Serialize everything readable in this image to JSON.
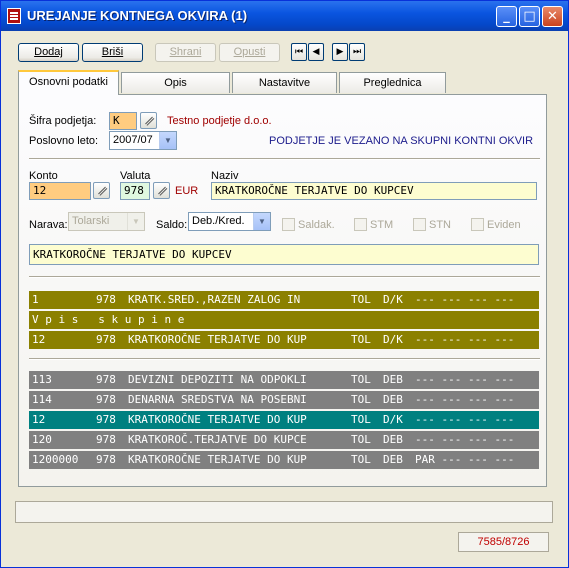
{
  "window": {
    "title": "UREJANJE KONTNEGA OKVIRA (1)",
    "minimize": "_",
    "maximize": "□",
    "close": "✕"
  },
  "toolbar": {
    "dodaj": "Dodaj",
    "brisi": "Briši",
    "shrani": "Shrani",
    "opusti": "Opusti",
    "nav_first": "⏮",
    "nav_prev": "◀",
    "nav_next": "▶",
    "nav_last": "⏭"
  },
  "tabs": [
    "Osnovni podatki",
    "Opis",
    "Nastavitve",
    "Preglednica"
  ],
  "form": {
    "sifra_label": "Šifra podjetja:",
    "sifra_value": "K",
    "company_name": "Testno podjetje d.o.o.",
    "leto_label": "Poslovno leto:",
    "leto_value": "2007/07",
    "notice": "PODJETJE JE VEZANO NA SKUPNI KONTNI OKVIR",
    "konto_label": "Konto",
    "konto_value": "12",
    "valuta_label": "Valuta",
    "valuta_value": "978",
    "valuta_code": "EUR",
    "naziv_label": "Naziv",
    "naziv_value": "KRATKOROČNE TERJATVE DO KUPCEV",
    "narava_label": "Narava:",
    "narava_value": "Tolarski",
    "saldo_label": "Saldo:",
    "saldo_value": "Deb./Kred.",
    "checks": [
      "Saldak.",
      "STM",
      "STN",
      "Eviden"
    ],
    "description": "KRATKOROČNE TERJATVE DO KUPCEV"
  },
  "group_rows": [
    {
      "konto": "1",
      "valuta": "978",
      "naziv": "KRATK.SRED.,RAZEN ZALOG IN",
      "cur": "TOL",
      "saldo": "D/K",
      "flags": "--- --- --- ---"
    },
    {
      "text": "V p i s   s k u p i n e"
    },
    {
      "konto": "12",
      "valuta": "978",
      "naziv": "KRATKOROČNE TERJATVE DO KUP",
      "cur": "TOL",
      "saldo": "D/K",
      "flags": "--- --- --- ---"
    }
  ],
  "account_rows": [
    {
      "konto": "113",
      "valuta": "978",
      "naziv": "DEVIZNI DEPOZITI NA ODPOKLI",
      "cur": "TOL",
      "saldo": "DEB",
      "flags": "--- --- --- ---"
    },
    {
      "konto": "114",
      "valuta": "978",
      "naziv": "DENARNA SREDSTVA NA POSEBNI",
      "cur": "TOL",
      "saldo": "DEB",
      "flags": "--- --- --- ---"
    },
    {
      "konto": "12",
      "valuta": "978",
      "naziv": "KRATKOROČNE TERJATVE DO KUP",
      "cur": "TOL",
      "saldo": "D/K",
      "flags": "--- --- --- ---"
    },
    {
      "konto": "120",
      "valuta": "978",
      "naziv": "KRATKOROČ.TERJATVE DO KUPCE",
      "cur": "TOL",
      "saldo": "DEB",
      "flags": "--- --- --- ---"
    },
    {
      "konto": "1200000",
      "valuta": "978",
      "naziv": "KRATKOROČNE TERJATVE DO KUP",
      "cur": "TOL",
      "saldo": "DEB",
      "flags": "PAR --- --- ---"
    }
  ],
  "status": {
    "counter": "7585/8726"
  },
  "colors": {
    "selected_row": "#008080",
    "group_row": "#8b8000",
    "list_row": "#808080",
    "notice": "#1c1c8c",
    "company": "#a00000"
  }
}
